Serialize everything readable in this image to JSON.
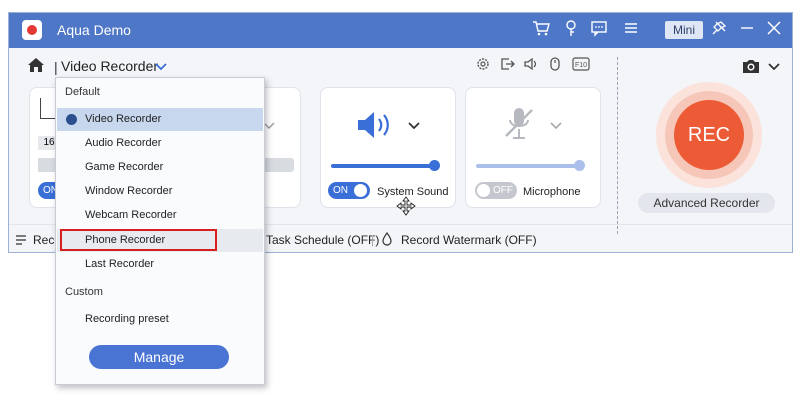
{
  "app": {
    "title": "Aqua Demo",
    "mini_label": "Mini"
  },
  "toolbar": {
    "breadcrumb": "Video Recorder",
    "separator": "|"
  },
  "panels": {
    "display": {
      "size_text": "16",
      "toggle": "ON"
    },
    "system_sound": {
      "toggle": "ON",
      "label": "System Sound"
    },
    "microphone": {
      "toggle": "OFF",
      "label": "Microphone"
    }
  },
  "record": {
    "rec_label": "REC",
    "advanced_label": "Advanced Recorder"
  },
  "statusbar": {
    "left_label": "Reco",
    "task_schedule": "Task Schedule (OFF)",
    "separator": "|",
    "watermark": "Record Watermark (OFF)"
  },
  "dropdown": {
    "section_default": "Default",
    "items": [
      "Video Recorder",
      "Audio Recorder",
      "Game Recorder",
      "Window Recorder",
      "Webcam Recorder",
      "Phone Recorder",
      "Last Recorder"
    ],
    "section_custom": "Custom",
    "preset": "Recording preset",
    "manage": "Manage"
  },
  "colors": {
    "titlebar": "#4e77c8",
    "accent": "#4a74d3",
    "rec": "#ec5b35",
    "highlight": "#d62020"
  }
}
